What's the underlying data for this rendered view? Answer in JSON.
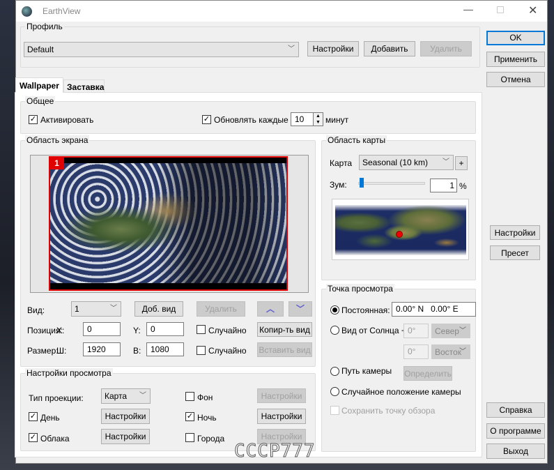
{
  "window": {
    "title": "EarthView"
  },
  "watermark": "CCCP777",
  "profile": {
    "label": "Профиль",
    "selected": "Default",
    "settings": "Настройки",
    "add": "Добавить",
    "delete": "Удалить"
  },
  "side": {
    "ok": "OK",
    "apply": "Применить",
    "cancel": "Отмена",
    "settings": "Настройки",
    "preset": "Пресет",
    "help": "Справка",
    "about": "О программе",
    "exit": "Выход"
  },
  "tabs": [
    {
      "label": "Wallpaper"
    },
    {
      "label": "Заставка"
    }
  ],
  "general": {
    "label": "Общее",
    "activate": "Активировать",
    "update": "Обновлять каждые",
    "interval": "10",
    "unit": "минут"
  },
  "screen": {
    "label": "Область экрана",
    "monitor": "1",
    "view_label": "Вид:",
    "view": "1",
    "add_view": "Доб. вид",
    "delete": "Удалить",
    "pos_label": "Позиция:",
    "x_label": "X:",
    "x": "0",
    "y_label": "Y:",
    "y": "0",
    "random": "Случайно",
    "copy": "Копир-ть вид",
    "size_label": "Размер:",
    "w_label": "Ш:",
    "w": "1920",
    "h_label": "В:",
    "h": "1080",
    "random2": "Случайно",
    "paste": "Вставить вид"
  },
  "viewset": {
    "label": "Настройки просмотра",
    "proj_label": "Тип проекции:",
    "proj": "Карта",
    "bg": "Фон",
    "day": "День",
    "night": "Ночь",
    "clouds": "Облака",
    "cities": "Города",
    "settings": "Настройки"
  },
  "maparea": {
    "label": "Область карты",
    "map_label": "Карта",
    "map": "Seasonal (10 km)",
    "plus": "+",
    "zoom_label": "Зум:",
    "zoom": "1",
    "pct": "%"
  },
  "viewpoint": {
    "label": "Точка просмотра",
    "fixed": "Постоянная:",
    "coords": "0.00° N   0.00° E",
    "sun": "Вид от Солнца +",
    "deg1": "0°",
    "dir1": "Север",
    "deg2": "0°",
    "dir2": "Восток",
    "path": "Путь камеры",
    "define": "Определить",
    "random": "Случайное положение камеры",
    "save": "Сохранить точку обзора"
  }
}
